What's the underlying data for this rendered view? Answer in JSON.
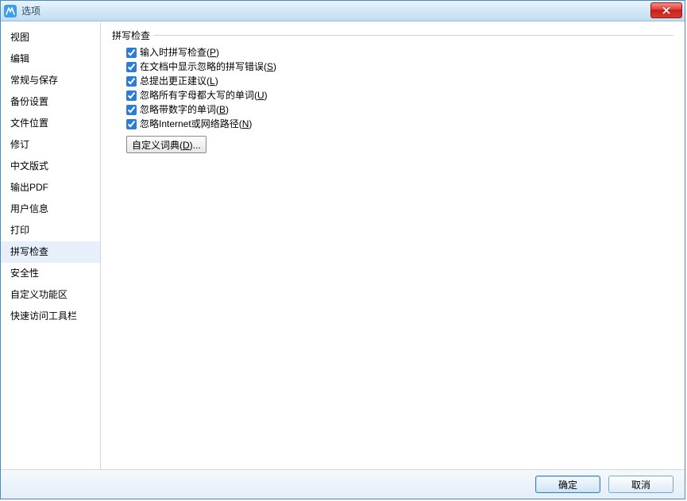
{
  "window": {
    "title": "选项"
  },
  "sidebar": {
    "items": [
      {
        "label": "视图",
        "selected": false
      },
      {
        "label": "编辑",
        "selected": false
      },
      {
        "label": "常规与保存",
        "selected": false
      },
      {
        "label": "备份设置",
        "selected": false
      },
      {
        "label": "文件位置",
        "selected": false
      },
      {
        "label": "修订",
        "selected": false
      },
      {
        "label": "中文版式",
        "selected": false
      },
      {
        "label": "输出PDF",
        "selected": false
      },
      {
        "label": "用户信息",
        "selected": false
      },
      {
        "label": "打印",
        "selected": false
      },
      {
        "label": "拼写检查",
        "selected": true
      },
      {
        "label": "安全性",
        "selected": false
      },
      {
        "label": "自定义功能区",
        "selected": false
      },
      {
        "label": "快速访问工具栏",
        "selected": false
      }
    ]
  },
  "content": {
    "group_title": "拼写检查",
    "options": [
      {
        "label": "输入时拼写检查(P)",
        "underline": "P",
        "checked": true
      },
      {
        "label": "在文档中显示忽略的拼写错误(S)",
        "underline": "S",
        "checked": true
      },
      {
        "label": "总提出更正建议(L)",
        "underline": "L",
        "checked": true
      },
      {
        "label": "忽略所有字母都大写的单词(U)",
        "underline": "U",
        "checked": true
      },
      {
        "label": "忽略带数字的单词(B)",
        "underline": "B",
        "checked": true
      },
      {
        "label": "忽略Internet或网络路径(N)",
        "underline": "N",
        "checked": true
      }
    ],
    "dict_button": "自定义词典(D)..."
  },
  "footer": {
    "ok": "确定",
    "cancel": "取消"
  }
}
